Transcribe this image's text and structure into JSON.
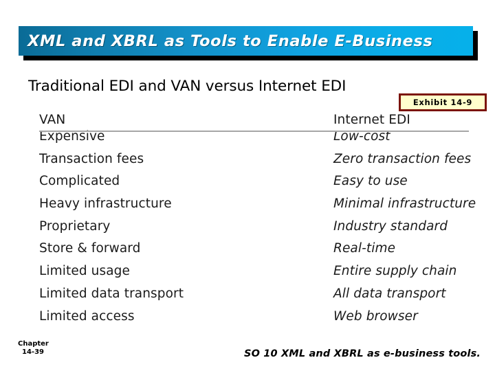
{
  "slide": {
    "title": "XML and XBRL as Tools to Enable E-Business",
    "subtitle": "Traditional EDI and VAN versus Internet EDI",
    "exhibit_badge": "Exhibit 14-9"
  },
  "colors": {
    "banner_gradient_start": "#0a6b96",
    "banner_gradient_end": "#06b0ea",
    "banner_text": "#ffffff",
    "banner_shadow": "#000000",
    "badge_border": "#7b1405",
    "badge_fill": "#ffffcc",
    "divider": "#a6a6a6",
    "body_text": "#1a1a1a",
    "background": "#ffffff"
  },
  "table": {
    "headers": [
      "VAN",
      "Internet EDI"
    ],
    "rows": [
      {
        "van": "Expensive",
        "internet_edi": "Low-cost"
      },
      {
        "van": "Transaction fees",
        "internet_edi": "Zero transaction fees"
      },
      {
        "van": "Complicated",
        "internet_edi": "Easy to use"
      },
      {
        "van": "Heavy infrastructure",
        "internet_edi": "Minimal infrastructure"
      },
      {
        "van": "Proprietary",
        "internet_edi": "Industry standard"
      },
      {
        "van": "Store & forward",
        "internet_edi": "Real-time"
      },
      {
        "van": "Limited usage",
        "internet_edi": "Entire supply chain"
      },
      {
        "van": "Limited data transport",
        "internet_edi": "All data transport"
      },
      {
        "van": "Limited access",
        "internet_edi": "Web browser"
      }
    ]
  },
  "footer": {
    "chapter_label": "Chapter",
    "chapter_number": "14-39",
    "learning_objective": "SO 10  XML and XBRL as e-business tools."
  }
}
